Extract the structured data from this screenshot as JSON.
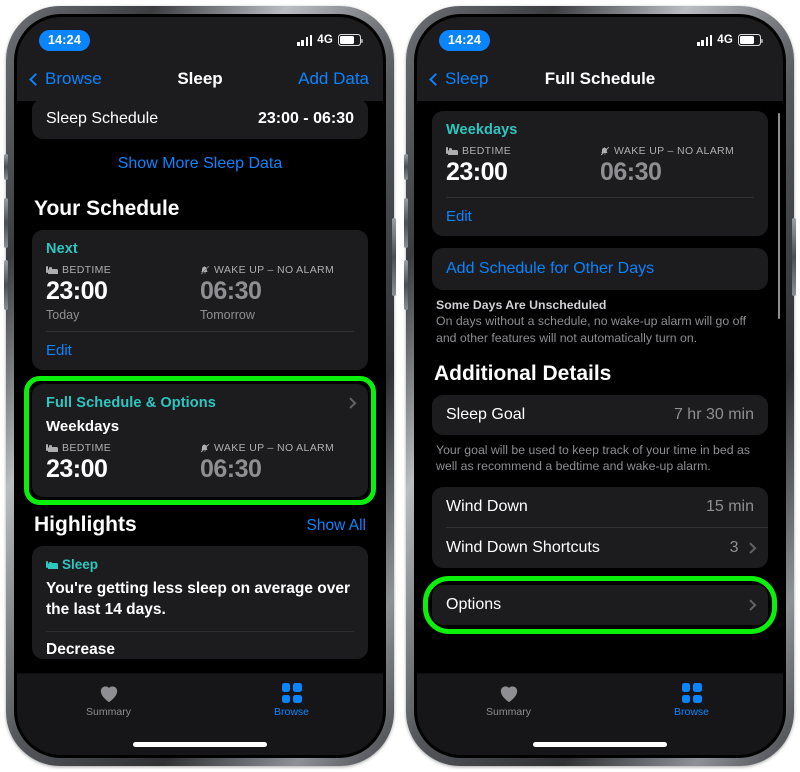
{
  "colors": {
    "accent_teal": "#2ec6c0",
    "link_blue": "#0a84ff",
    "highlight_green": "#0af00a",
    "card_bg": "#1c1c1e",
    "screen_bg": "#000000",
    "secondary_text": "#8e8e93"
  },
  "left_phone": {
    "status": {
      "time": "14:24",
      "network": "4G",
      "signal_icon": "cellular-bars-icon",
      "battery_icon": "battery-icon"
    },
    "nav": {
      "back_label": "Browse",
      "back_icon": "chevron-left-icon",
      "title": "Sleep",
      "action_label": "Add Data"
    },
    "sleep_schedule_row": {
      "label": "Sleep Schedule",
      "value": "23:00 - 06:30"
    },
    "show_more_link": "Show More Sleep Data",
    "your_schedule": {
      "section_title": "Your Schedule",
      "next_label": "Next",
      "bedtime_label": "BEDTIME",
      "bedtime_icon": "bed-icon",
      "bedtime_value": "23:00",
      "bedtime_sub": "Today",
      "wake_label": "WAKE UP – NO ALARM",
      "wake_icon": "bell-slash-icon",
      "wake_value": "06:30",
      "wake_sub": "Tomorrow",
      "edit_label": "Edit"
    },
    "full_schedule_card": {
      "title": "Full Schedule & Options",
      "chevron_icon": "chevron-right-icon",
      "days": "Weekdays",
      "bedtime_label": "BEDTIME",
      "bedtime_icon": "bed-icon",
      "bedtime_value": "23:00",
      "wake_label": "WAKE UP – NO ALARM",
      "wake_icon": "bell-slash-icon",
      "wake_value": "06:30",
      "highlighted": true
    },
    "highlights": {
      "section_title": "Highlights",
      "show_all_label": "Show All",
      "card_category": "Sleep",
      "card_icon": "bed-icon",
      "card_text": "You're getting less sleep on average over the last 14 days.",
      "next_partial": "Decrease"
    },
    "tabbar": {
      "tabs": [
        {
          "label": "Summary",
          "icon": "heart-icon",
          "active": false
        },
        {
          "label": "Browse",
          "icon": "grid-squares-icon",
          "active": true
        }
      ]
    }
  },
  "right_phone": {
    "status": {
      "time": "14:24",
      "network": "4G",
      "signal_icon": "cellular-bars-icon",
      "battery_icon": "battery-icon"
    },
    "nav": {
      "back_label": "Sleep",
      "back_icon": "chevron-left-icon",
      "title": "Full Schedule",
      "action_label": ""
    },
    "weekdays_card": {
      "days": "Weekdays",
      "bedtime_label": "BEDTIME",
      "bedtime_icon": "bed-icon",
      "bedtime_value": "23:00",
      "wake_label": "WAKE UP – NO ALARM",
      "wake_icon": "bell-slash-icon",
      "wake_value": "06:30",
      "edit_label": "Edit"
    },
    "add_schedule_link": "Add Schedule for Other Days",
    "unscheduled_note": {
      "title": "Some Days Are Unscheduled",
      "body": "On days without a schedule, no wake-up alarm will go off and other features will not automatically turn on."
    },
    "additional_details": {
      "section_title": "Additional Details",
      "rows": [
        {
          "label": "Sleep Goal",
          "value": "7 hr 30 min",
          "chevron": false
        },
        {
          "label": "Wind Down",
          "value": "15 min",
          "chevron": false
        },
        {
          "label": "Wind Down Shortcuts",
          "value": "3",
          "chevron": true
        },
        {
          "label": "Options",
          "value": "",
          "chevron": true
        }
      ],
      "goal_note": "Your goal will be used to keep track of your time in bed as well as recommend a bedtime and wake-up alarm."
    },
    "options_highlighted": true,
    "tabbar": {
      "tabs": [
        {
          "label": "Summary",
          "icon": "heart-icon",
          "active": false
        },
        {
          "label": "Browse",
          "icon": "grid-squares-icon",
          "active": true
        }
      ]
    }
  }
}
